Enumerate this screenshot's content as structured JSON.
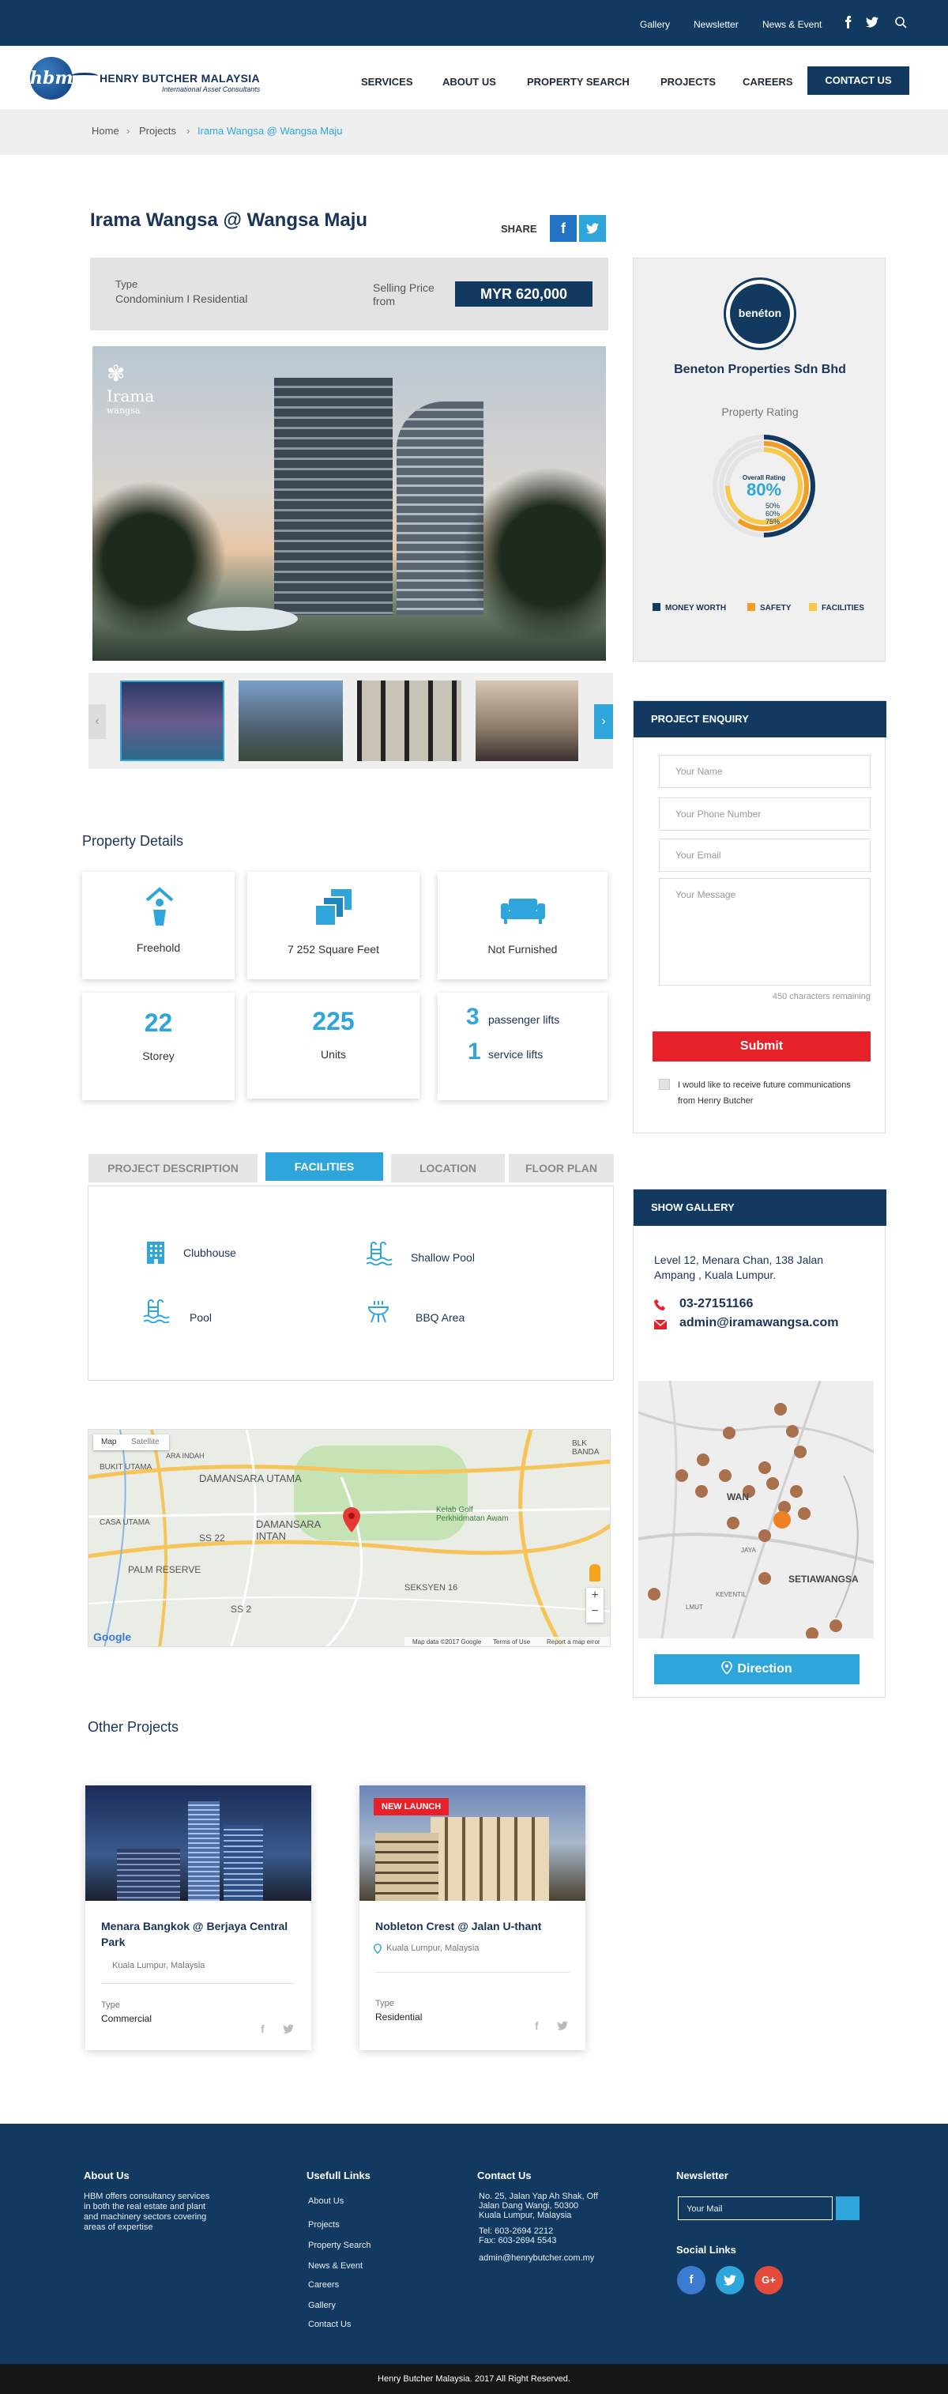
{
  "topbar": {
    "links": [
      "Gallery",
      "Newsletter",
      "News & Event"
    ],
    "icons": [
      "facebook-icon",
      "twitter-icon",
      "search-icon"
    ]
  },
  "header": {
    "logo_mark": "hbm",
    "brand": "HENRY BUTCHER MALAYSIA",
    "tagline": "International Asset Consultants",
    "nav": [
      "SERVICES",
      "ABOUT US",
      "PROPERTY SEARCH",
      "PROJECTS",
      "CAREERS"
    ],
    "cta": "CONTACT US"
  },
  "breadcrumb": [
    "Home",
    "Projects",
    "Irama Wangsa @ Wangsa Maju"
  ],
  "project": {
    "title": "Irama Wangsa @ Wangsa Maju",
    "share_label": "SHARE",
    "type_label": "Type",
    "type_value": "Condominium I Residential",
    "price_label": "Selling Price from",
    "price": "MYR 620,000",
    "image_logo": "Irama",
    "image_logo_sub": "wangsa"
  },
  "developer": {
    "logo_text": "benéton",
    "name": "Beneton Properties Sdn Bhd",
    "rating_label": "Property Rating",
    "overall_label": "Overall Rating",
    "overall_value": "80%",
    "ring_values": [
      0.5,
      0.6,
      0.75
    ],
    "ring_labels": [
      "50%",
      "60%",
      "75%"
    ],
    "legend": [
      "MONEY WORTH",
      "SAFETY",
      "FACILITIES"
    ],
    "colors": {
      "money": "#123a60",
      "safety": "#f39c23",
      "facilities": "#f6c94b"
    }
  },
  "details": {
    "title": "Property Details",
    "tenure": "Freehold",
    "area": "7 252 Square Feet",
    "furnish": "Not Furnished",
    "storey_num": "22",
    "storey_lbl": "Storey",
    "units_num": "225",
    "units_lbl": "Units",
    "plifts_num": "3",
    "plifts_lbl": "passenger lifts",
    "slifts_num": "1",
    "slifts_lbl": "service lifts"
  },
  "enquiry": {
    "title": "PROJECT ENQUIRY",
    "name_ph": "Your Name",
    "phone_ph": "Your Phone Number",
    "email_ph": "Your Email",
    "message_ph": "Your Message",
    "chars": "450 characters remaining",
    "submit": "Submit",
    "consent": "I would like to receive future communications from Henry Butcher"
  },
  "tabs": [
    "PROJECT DESCRIPTION",
    "FACILITIES",
    "LOCATION",
    "FLOOR PLAN"
  ],
  "facilities": [
    "Clubhouse",
    "Shallow Pool",
    "Pool",
    "BBQ Area"
  ],
  "gallery": {
    "title": "SHOW GALLERY",
    "address": "Level 12, Menara Chan, 138 Jalan Ampang , Kuala Lumpur.",
    "phone": "03-27151166",
    "email": "admin@iramawangsa.com",
    "direction": "Direction"
  },
  "map": {
    "tab_map": "Map",
    "tab_sat": "Satellite",
    "labels": [
      "BUKIT UTAMA",
      "ARA INDAH",
      "DAMANSARA UTAMA",
      "DAMANSARA INTAN",
      "CASA UTAMA",
      "PALM RESERVE",
      "SS 22",
      "SS 2",
      "SEKSYEN 16",
      "Kelab Golf Perkhidmatan Awam",
      "BLK BANDA"
    ],
    "attrib": "Map data ©2017 Google",
    "terms": "Terms of Use",
    "report": "Report a map error",
    "google": "Google"
  },
  "side_map": {
    "labels": [
      "SETIAWANGSA",
      "KEVENTIL",
      "WAN",
      "JAYA",
      "LMUT"
    ]
  },
  "other": {
    "title": "Other Projects",
    "cards": [
      {
        "name": "Menara Bangkok @ Berjaya Central Park",
        "location": "Kuala Lumpur, Malaysia",
        "type_label": "Type",
        "type": "Commercial",
        "badge": ""
      },
      {
        "name": "Nobleton Crest @ Jalan U-thant",
        "location": "Kuala Lumpur, Malaysia",
        "type_label": "Type",
        "type": "Residential",
        "badge": "NEW LAUNCH"
      }
    ]
  },
  "footer": {
    "about_title": "About Us",
    "about_text": "HBM offers consultancy services in both the real estate and plant and machinery sectors covering areas of expertise",
    "links_title": "Usefull Links",
    "links": [
      "About Us",
      "Projects",
      "Property Search",
      "News & Event",
      "Careers",
      "Gallery",
      "Contact Us"
    ],
    "contact_title": "Contact Us",
    "address": [
      "No. 25, Jalan Yap Ah Shak, Off",
      "Jalan Dang Wangi, 50300",
      "Kuala Lumpur, Malaysia"
    ],
    "tel": "Tel: 603-2694 2212",
    "fax": "Fax: 603-2694 5543",
    "email": "admin@henrybutcher.com.my",
    "newsletter_title": "Newsletter",
    "mail_ph": "Your Mail",
    "social_title": "Social Links",
    "copyright": "Henry Butcher Malaysia. 2017 All Right Reserved."
  }
}
